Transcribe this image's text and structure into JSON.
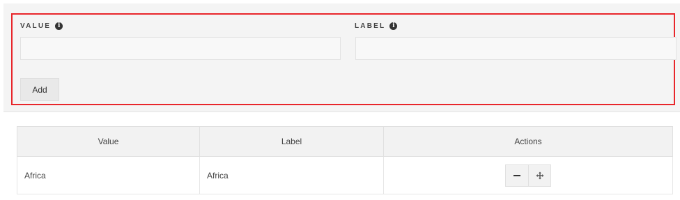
{
  "form": {
    "value_label": "VALUE",
    "label_label": "LABEL",
    "value_input": {
      "value": "",
      "placeholder": ""
    },
    "label_input": {
      "value": "",
      "placeholder": ""
    },
    "add_button": "Add",
    "info_icon": "info-circle-icon"
  },
  "table": {
    "columns": [
      "Value",
      "Label",
      "Actions"
    ],
    "rows": [
      {
        "value": "Africa",
        "label": "Africa",
        "actions": [
          "minus-icon",
          "move-icon"
        ]
      }
    ]
  },
  "colors": {
    "highlight_border": "#e8262b",
    "panel_background": "#f4f4f4"
  }
}
